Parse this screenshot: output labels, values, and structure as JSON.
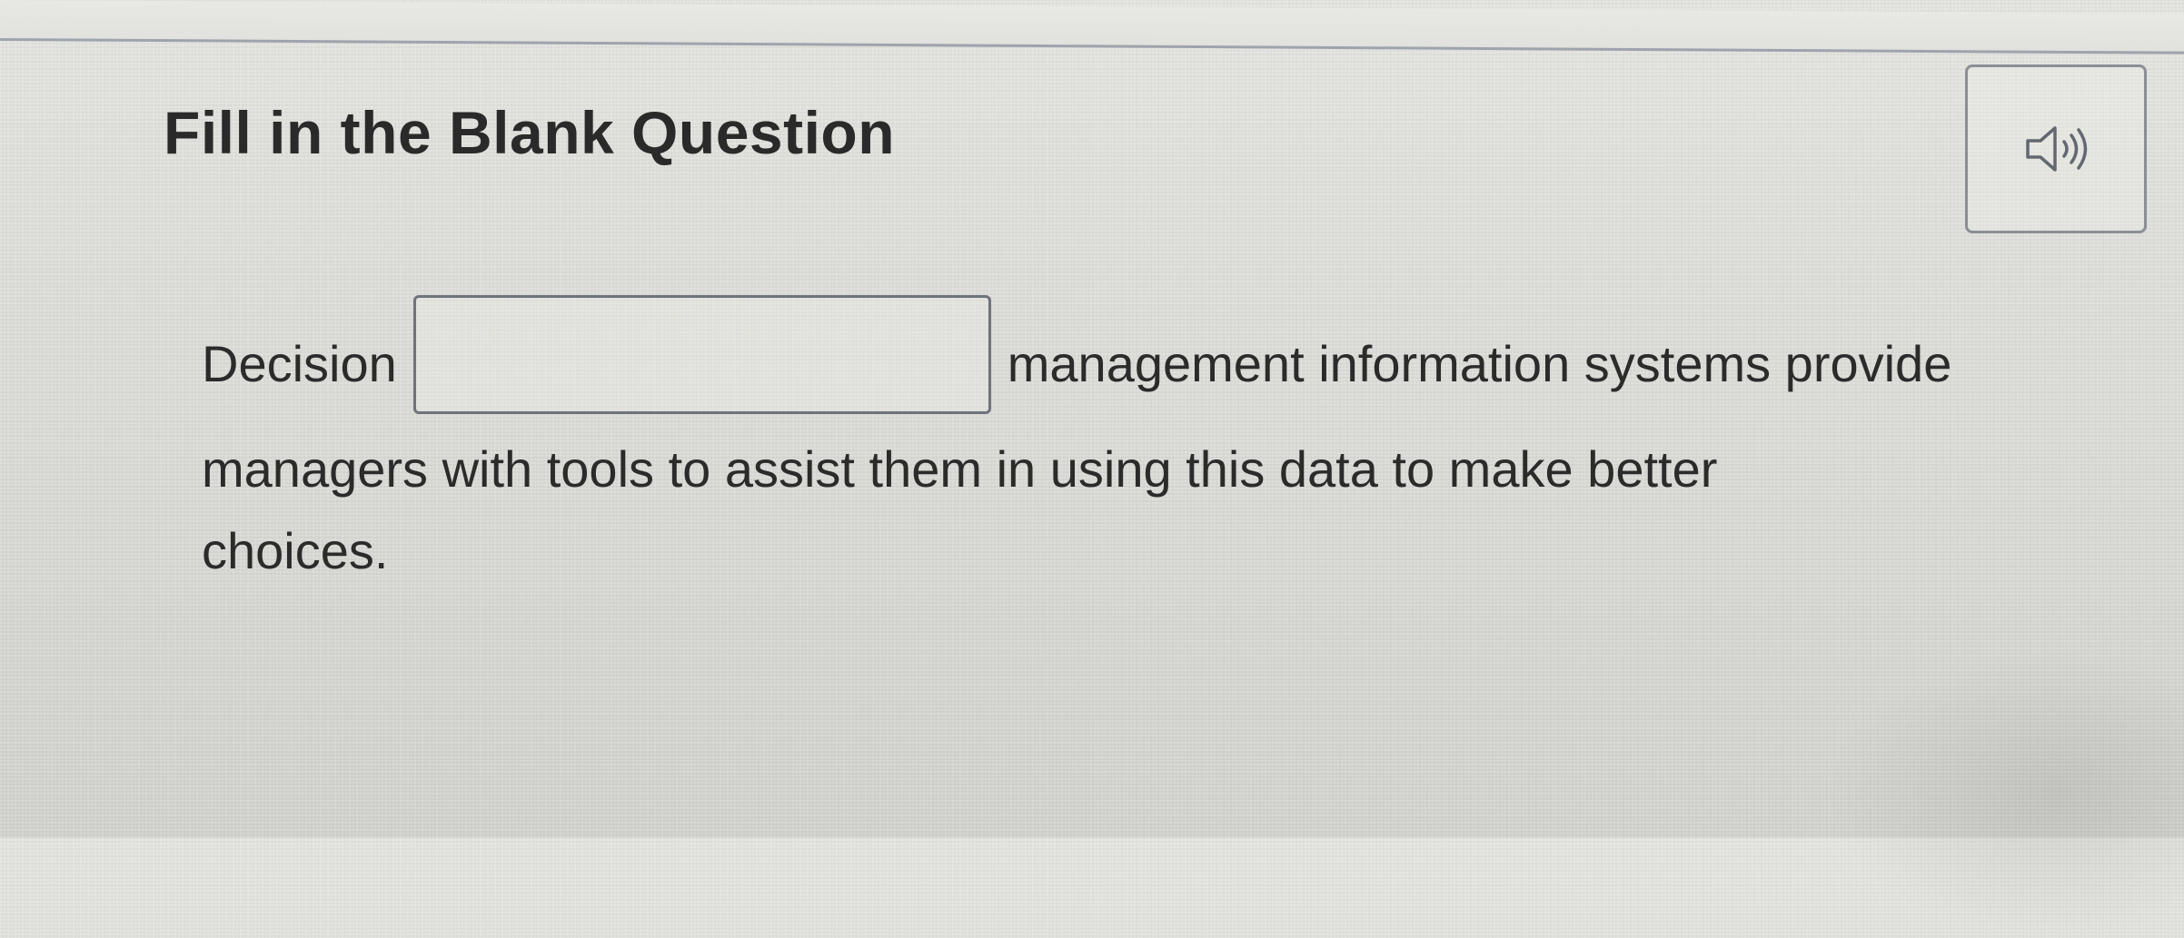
{
  "question": {
    "title": "Fill in the Blank Question",
    "audio_icon": "speaker-icon",
    "text_before_blank": "Decision",
    "blank_value": "",
    "text_after_blank": "management information systems provide",
    "line_2": "managers with tools to assist them in using this data to make better",
    "line_3": "choices."
  },
  "colors": {
    "background": "#dcdcd7",
    "text": "#2b2b2b",
    "border": "#6e747c"
  }
}
